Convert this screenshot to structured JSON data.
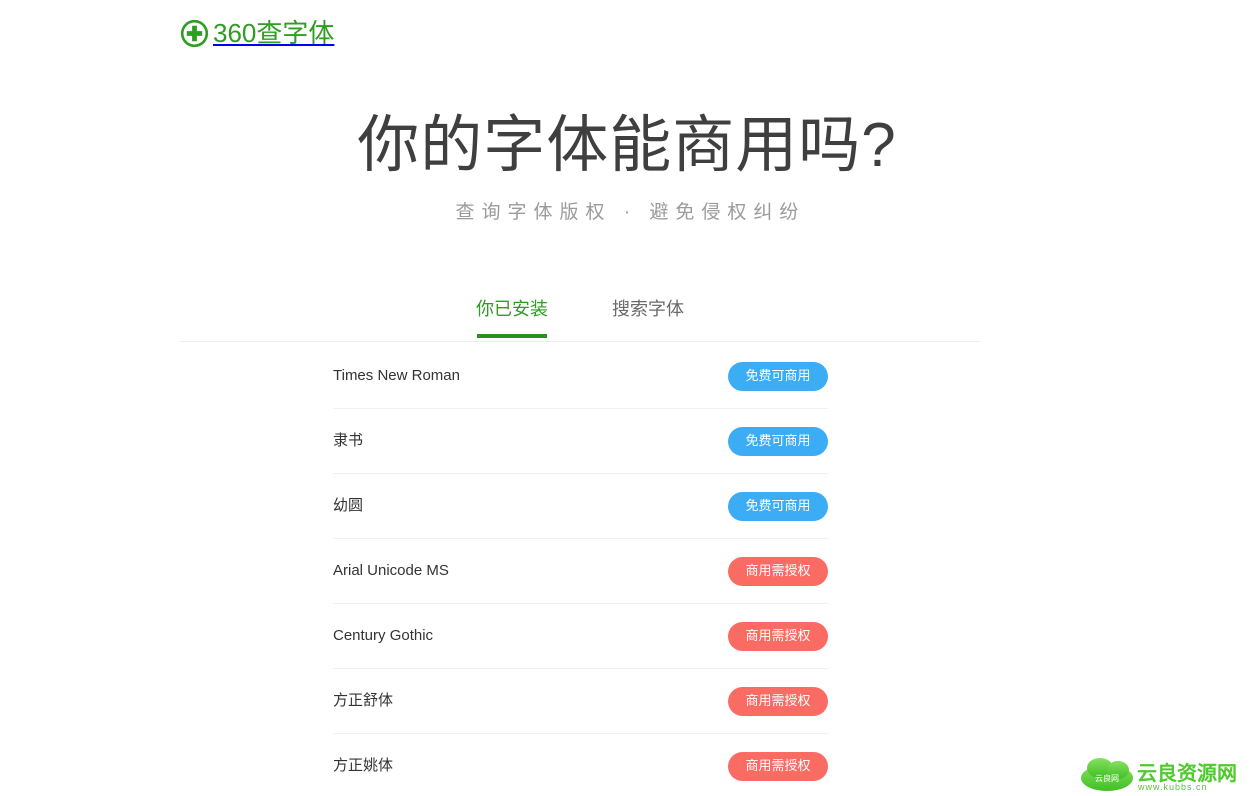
{
  "header": {
    "logo_icon": "circle-plus-icon",
    "logo_text": "360查字体"
  },
  "hero": {
    "title": "你的字体能商用吗?",
    "subtitle": "查询字体版权 · 避免侵权纠纷"
  },
  "tabs": [
    {
      "label": "你已安装",
      "active": true
    },
    {
      "label": "搜索字体",
      "active": false
    }
  ],
  "font_list": [
    {
      "name": "Times New Roman",
      "status": "免费可商用",
      "status_type": "free"
    },
    {
      "name": "隶书",
      "status": "免费可商用",
      "status_type": "free"
    },
    {
      "name": "幼圆",
      "status": "免费可商用",
      "status_type": "free"
    },
    {
      "name": "Arial Unicode MS",
      "status": "商用需授权",
      "status_type": "licensed"
    },
    {
      "name": "Century Gothic",
      "status": "商用需授权",
      "status_type": "licensed"
    },
    {
      "name": "方正舒体",
      "status": "商用需授权",
      "status_type": "licensed"
    },
    {
      "name": "方正姚体",
      "status": "商用需授权",
      "status_type": "licensed"
    }
  ],
  "watermark": {
    "cloud_label": "云良网",
    "site_name": "云良资源网",
    "url": "www.kubbs.cn"
  },
  "colors": {
    "brand_green": "#2e9e22",
    "tab_underline": "#2b8f1d",
    "badge_free": "#3cadf5",
    "badge_licensed": "#fa6b64",
    "title_gray": "#3f3f3f",
    "subtitle_gray": "#9b9b9b",
    "watermark_green": "#5fce3f"
  }
}
